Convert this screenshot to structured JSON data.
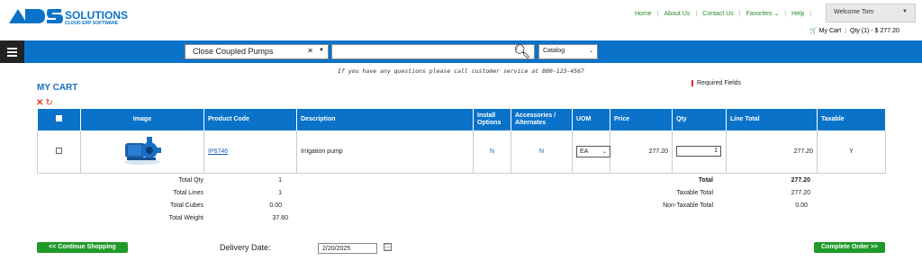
{
  "brand": {
    "logo_mark": "ADS",
    "logo_name": "SOLUTIONS",
    "logo_tagline": "CLOUD ERP SOFTWARE"
  },
  "topnav": {
    "links": [
      "Home",
      "About Us",
      "Contact Us",
      "Favorites",
      "Help"
    ],
    "welcome": "Welcome Tom",
    "cart_label": "My Cart",
    "cart_summary": "Qty (1) - $ 277.20"
  },
  "searchbar": {
    "category_value": "Close Coupled Pumps",
    "search_value": "",
    "scope_value": "Catalog"
  },
  "notice": "If you have any questions please call customer service at 800-123-4567",
  "page_title": "MY CART",
  "required_fields": "Required Fields",
  "table": {
    "headers": [
      "",
      "Image",
      "Product Code",
      "Description",
      "Install Options",
      "Accessories / Alternates",
      "UOM",
      "Price",
      "Qty",
      "Line Total",
      "Taxable"
    ],
    "rows": [
      {
        "product_code": "IP6746",
        "description": "Irrigation pump",
        "install_options": "N",
        "accessories": "N",
        "uom": "EA",
        "price": "277.20",
        "qty": "1",
        "line_total": "277.20",
        "taxable": "Y"
      }
    ]
  },
  "summary_left": {
    "total_qty_label": "Total Qty",
    "total_qty": "1",
    "total_lines_label": "Total Lines",
    "total_lines": "1",
    "total_cubes_label": "Total Cubes",
    "total_cubes": "0.00",
    "total_weight_label": "Total Weight",
    "total_weight": "37.60"
  },
  "summary_right": {
    "total_label": "Total",
    "total": "277.20",
    "taxable_label": "Taxable Total",
    "taxable": "277.20",
    "nontaxable_label": "Non-Taxable Total",
    "nontaxable": "0.00"
  },
  "footer": {
    "continue_label": "<< Continue Shopping",
    "delivery_label": "Delivery Date:",
    "delivery_value": "2/20/2025",
    "complete_label": "Complete Order >>"
  },
  "colors": {
    "primary_blue": "#0a73c9",
    "green": "#1f9a28",
    "link_blue": "#1a5fb4",
    "danger": "#e03a1e"
  }
}
